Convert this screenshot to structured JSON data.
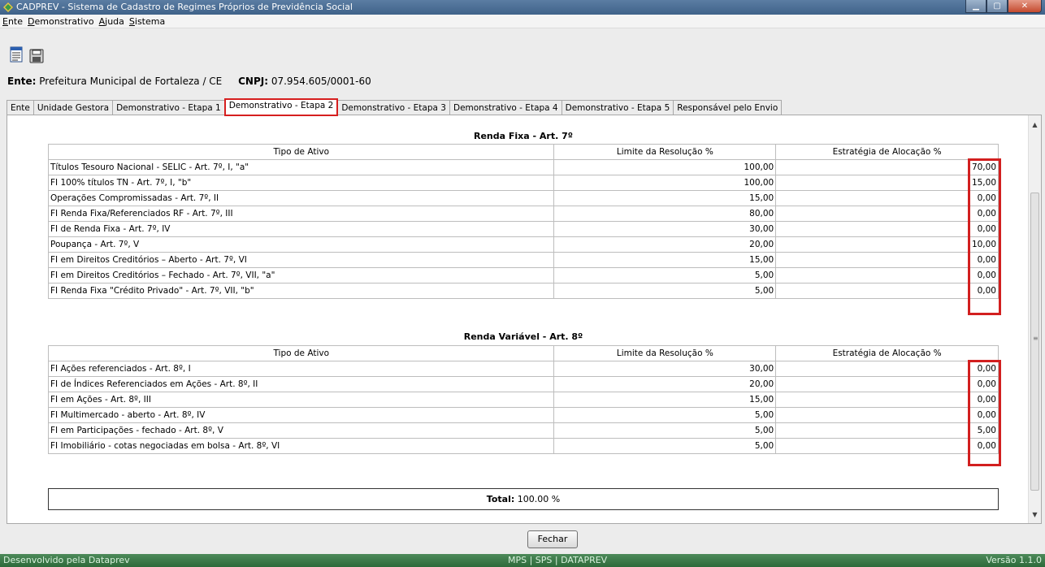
{
  "window": {
    "title": "CADPREV - Sistema de Cadastro de Regimes Próprios de Previdência Social",
    "min": "▁",
    "max": "▢",
    "close": "✕"
  },
  "menu": [
    "Ente",
    "Demonstrativo",
    "Ajuda",
    "Sistema"
  ],
  "toolbar": {
    "icons": [
      "document-icon",
      "save-icon"
    ]
  },
  "ente": {
    "label": "Ente:",
    "value": "Prefeitura Municipal de Fortaleza / CE",
    "cnpj_label": "CNPJ:",
    "cnpj_value": "07.954.605/0001-60"
  },
  "tabs": [
    {
      "label": "Ente"
    },
    {
      "label": "Unidade Gestora"
    },
    {
      "label": "Demonstrativo - Etapa 1"
    },
    {
      "label": "Demonstrativo - Etapa 2",
      "active": true
    },
    {
      "label": "Demonstrativo - Etapa 3"
    },
    {
      "label": "Demonstrativo - Etapa 4"
    },
    {
      "label": "Demonstrativo - Etapa 5"
    },
    {
      "label": "Responsável pelo Envio"
    }
  ],
  "renda_fixa": {
    "title": "Renda Fixa - Art. 7º",
    "headers": [
      "Tipo de Ativo",
      "Limite da Resolução %",
      "Estratégia de Alocação %"
    ],
    "rows": [
      [
        "Títulos Tesouro Nacional - SELIC - Art. 7º, I, \"a\"",
        "100,00",
        "70,00"
      ],
      [
        "FI 100% títulos TN - Art. 7º, I, \"b\"",
        "100,00",
        "15,00"
      ],
      [
        "Operações Compromissadas - Art. 7º, II",
        "15,00",
        "0,00"
      ],
      [
        "FI Renda Fixa/Referenciados RF - Art. 7º, III",
        "80,00",
        "0,00"
      ],
      [
        "FI de Renda Fixa - Art. 7º, IV",
        "30,00",
        "0,00"
      ],
      [
        "Poupança - Art. 7º, V",
        "20,00",
        "10,00"
      ],
      [
        "FI em Direitos Creditórios – Aberto - Art. 7º, VI",
        "15,00",
        "0,00"
      ],
      [
        "FI em Direitos Creditórios – Fechado - Art. 7º, VII, \"a\"",
        "5,00",
        "0,00"
      ],
      [
        "FI Renda Fixa \"Crédito Privado\" - Art. 7º, VII, \"b\"",
        "5,00",
        "0,00"
      ]
    ]
  },
  "renda_variavel": {
    "title": "Renda Variável - Art. 8º",
    "headers": [
      "Tipo de Ativo",
      "Limite da Resolução %",
      "Estratégia de Alocação %"
    ],
    "rows": [
      [
        "FI Ações referenciados - Art. 8º, I",
        "30,00",
        "0,00"
      ],
      [
        "FI de Índices Referenciados em Ações - Art. 8º, II",
        "20,00",
        "0,00"
      ],
      [
        "FI em Ações - Art. 8º, III",
        "15,00",
        "0,00"
      ],
      [
        "FI Multimercado - aberto - Art. 8º, IV",
        "5,00",
        "0,00"
      ],
      [
        "FI em Participações - fechado - Art. 8º, V",
        "5,00",
        "5,00"
      ],
      [
        "FI Imobiliário - cotas negociadas em bolsa - Art. 8º, VI",
        "5,00",
        "0,00"
      ]
    ]
  },
  "total": {
    "label": "Total:",
    "value": "100.00 %"
  },
  "close_button": "Fechar",
  "status": {
    "left": "Desenvolvido pela Dataprev",
    "center": "MPS | SPS | DATAPREV",
    "right": "Versão 1.1.0"
  }
}
